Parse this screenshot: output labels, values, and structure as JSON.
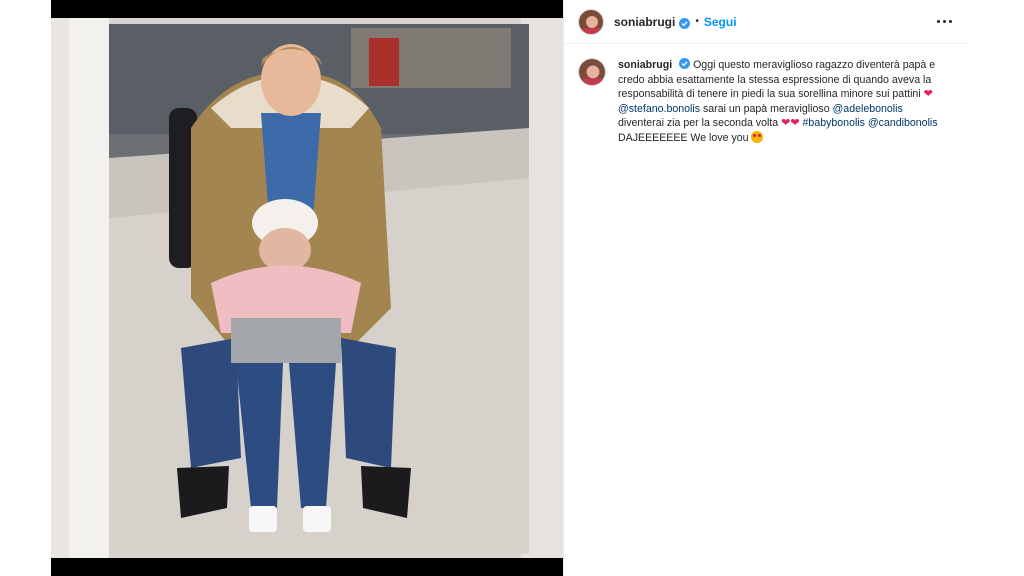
{
  "post": {
    "username": "soniabrugi",
    "dot": "•",
    "follow_label": "Segui",
    "more_icon": "more-horizontal-icon",
    "verified_icon": "verified-badge-icon"
  },
  "caption": {
    "username": "soniabrugi",
    "text_1": "Oggi questo meraviglioso ragazzo diventerà papà e credo abbia esattamente la stessa espressione di quando aveva la responsabilità di tenere in piedi la sua sorellina minore sui pattini",
    "mention_1": "@stefano.bonolis",
    "text_2": "sarai un papà meraviglioso",
    "mention_2": "@adelebonolis",
    "text_3": "diventerai zia per la seconda volta",
    "hashtag_1": "#babybonolis",
    "mention_3": "@candibonolis",
    "text_4": "DAJEEEEEEE We love you",
    "heart": "❤"
  },
  "colors": {
    "link": "#00376b",
    "follow": "#0095f6",
    "heart": "#e0245e"
  }
}
